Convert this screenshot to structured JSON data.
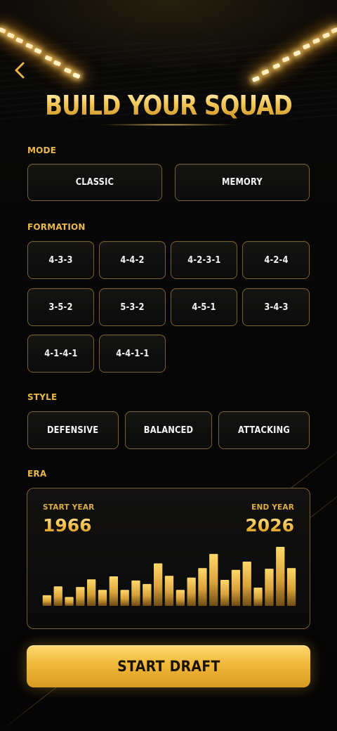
{
  "header": {
    "title": "BUILD YOUR SQUAD",
    "back_icon": "chevron-left-icon"
  },
  "mode": {
    "label": "MODE",
    "options": [
      "CLASSIC",
      "MEMORY"
    ]
  },
  "formation": {
    "label": "FORMATION",
    "options": [
      "4-3-3",
      "4-4-2",
      "4-2-3-1",
      "4-2-4",
      "3-5-2",
      "5-3-2",
      "4-5-1",
      "3-4-3",
      "4-1-4-1",
      "4-4-1-1"
    ]
  },
  "style": {
    "label": "STYLE",
    "options": [
      "DEFENSIVE",
      "BALANCED",
      "ATTACKING"
    ]
  },
  "era": {
    "label": "ERA",
    "start_caption": "START YEAR",
    "start_year": "1966",
    "end_caption": "END YEAR",
    "end_year": "2026",
    "histogram_levels": [
      0.18,
      0.33,
      0.15,
      0.32,
      0.45,
      0.27,
      0.5,
      0.27,
      0.43,
      0.37,
      0.72,
      0.51,
      0.27,
      0.48,
      0.64,
      0.88,
      0.44,
      0.61,
      0.75,
      0.31,
      0.63,
      1.0,
      0.64
    ]
  },
  "actions": {
    "start_label": "START DRAFT"
  },
  "colors": {
    "accent": "#f0b93a",
    "accent_light": "#ffd970",
    "label": "#e9b94b",
    "border": "#d6a448",
    "background": "#060606"
  }
}
